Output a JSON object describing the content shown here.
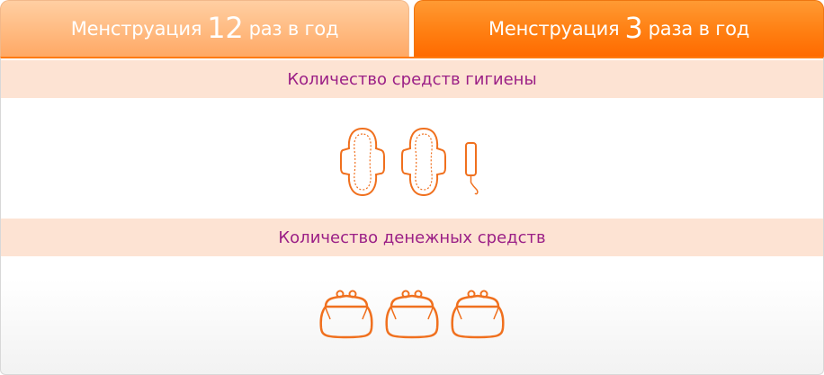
{
  "tabs": [
    {
      "prefix": "Менструация",
      "number": "12",
      "suffix": "раз в год",
      "active": false
    },
    {
      "prefix": "Менструация",
      "number": "3",
      "suffix": "раза в год",
      "active": true
    }
  ],
  "sections": {
    "hygiene": {
      "title": "Количество средств гигиены",
      "icons": [
        "pad-icon",
        "pad-icon",
        "tampon-icon"
      ]
    },
    "money": {
      "title": "Количество денежных средств",
      "icons": [
        "purse-icon",
        "purse-icon",
        "purse-icon"
      ]
    }
  },
  "colors": {
    "accent": "#ff7a10",
    "band": "#fde3d3",
    "heading": "#9b1f86",
    "icon_stroke": "#f0701e"
  }
}
